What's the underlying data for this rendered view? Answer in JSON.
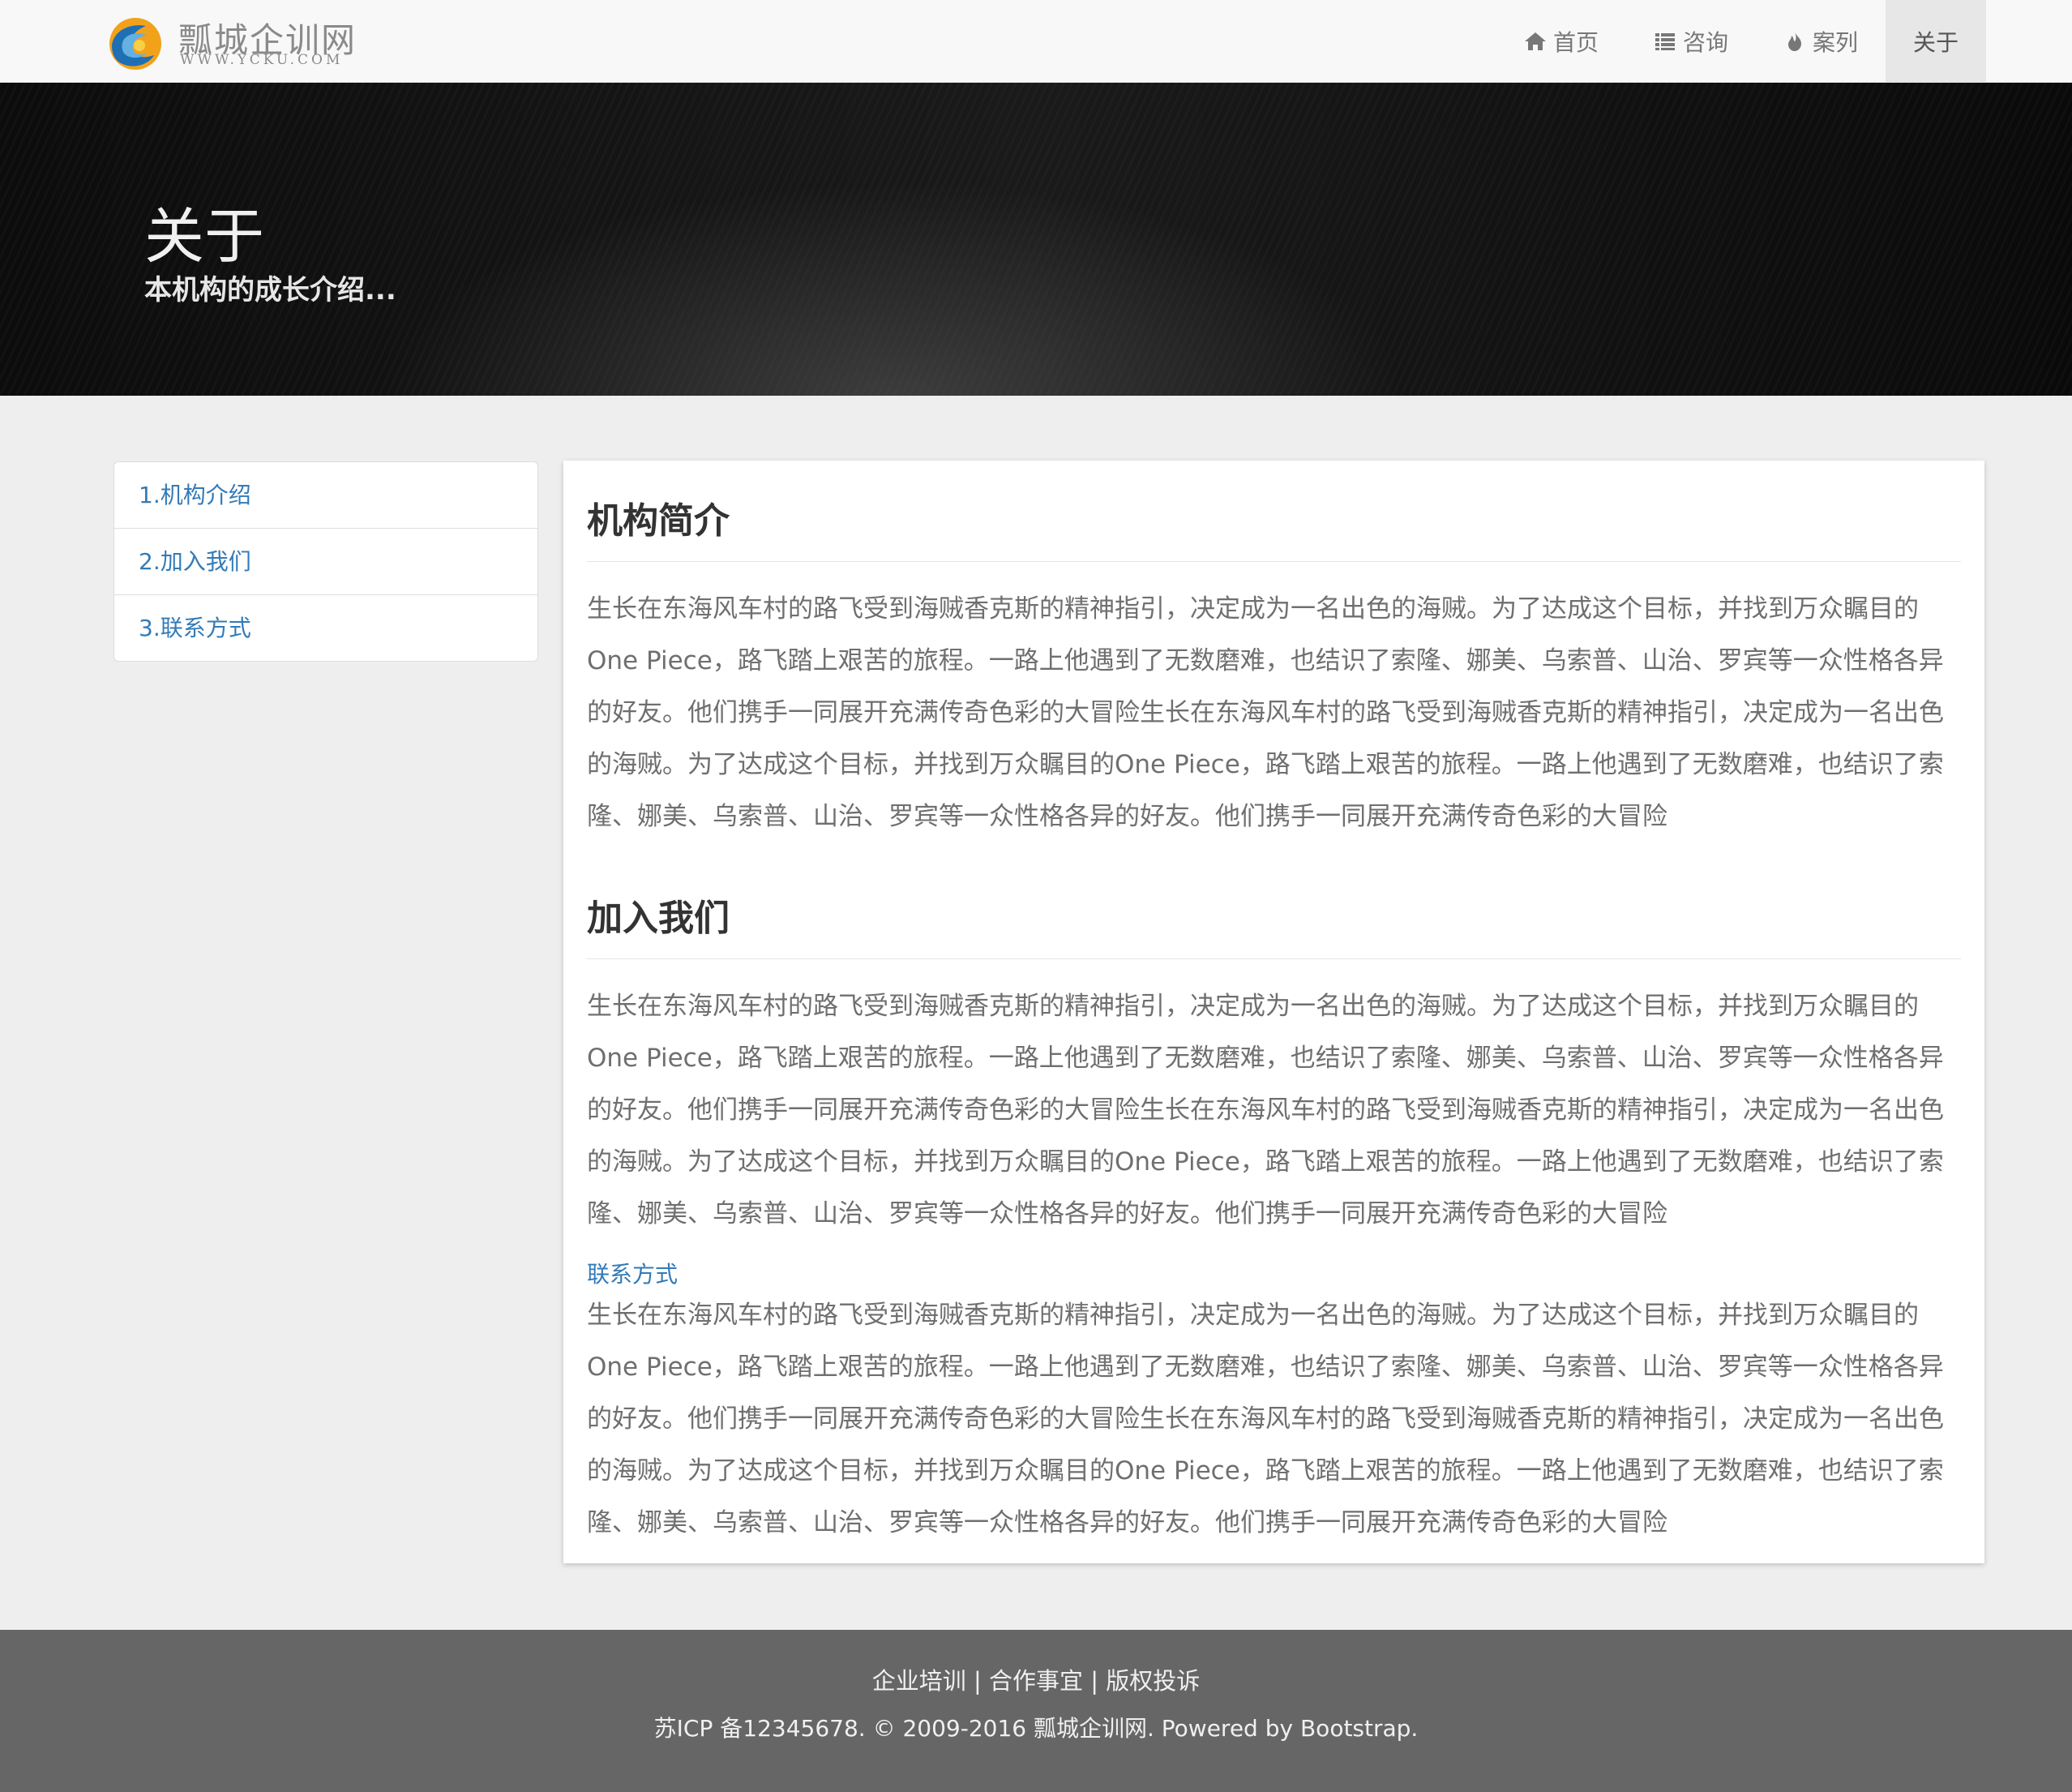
{
  "brand": {
    "title": "瓢城企训网",
    "subtitle": "WWW.YCKU.COM"
  },
  "nav": {
    "items": [
      {
        "label": "首页",
        "icon": "home-icon"
      },
      {
        "label": "咨询",
        "icon": "list-icon"
      },
      {
        "label": "案列",
        "icon": "fire-icon"
      },
      {
        "label": "关于",
        "icon": ""
      }
    ],
    "active_index": 3
  },
  "hero": {
    "title": "关于",
    "subtitle": "本机构的成长介绍..."
  },
  "sidebar": {
    "items": [
      {
        "label": "1.机构介绍"
      },
      {
        "label": "2.加入我们"
      },
      {
        "label": "3.联系方式"
      }
    ]
  },
  "content": {
    "sections": [
      {
        "heading": "机构简介",
        "text": "生长在东海风车村的路飞受到海贼香克斯的精神指引，决定成为一名出色的海贼。为了达成这个目标，并找到万众瞩目的One Piece，路飞踏上艰苦的旅程。一路上他遇到了无数磨难，也结识了索隆、娜美、乌索普、山治、罗宾等一众性格各异的好友。他们携手一同展开充满传奇色彩的大冒险生长在东海风车村的路飞受到海贼香克斯的精神指引，决定成为一名出色的海贼。为了达成这个目标，并找到万众瞩目的One Piece，路飞踏上艰苦的旅程。一路上他遇到了无数磨难，也结识了索隆、娜美、乌索普、山治、罗宾等一众性格各异的好友。他们携手一同展开充满传奇色彩的大冒险"
      },
      {
        "heading": "加入我们",
        "text": "生长在东海风车村的路飞受到海贼香克斯的精神指引，决定成为一名出色的海贼。为了达成这个目标，并找到万众瞩目的One Piece，路飞踏上艰苦的旅程。一路上他遇到了无数磨难，也结识了索隆、娜美、乌索普、山治、罗宾等一众性格各异的好友。他们携手一同展开充满传奇色彩的大冒险生长在东海风车村的路飞受到海贼香克斯的精神指引，决定成为一名出色的海贼。为了达成这个目标，并找到万众瞩目的One Piece，路飞踏上艰苦的旅程。一路上他遇到了无数磨难，也结识了索隆、娜美、乌索普、山治、罗宾等一众性格各异的好友。他们携手一同展开充满传奇色彩的大冒险"
      }
    ],
    "contact": {
      "label": "联系方式",
      "text": "生长在东海风车村的路飞受到海贼香克斯的精神指引，决定成为一名出色的海贼。为了达成这个目标，并找到万众瞩目的One Piece，路飞踏上艰苦的旅程。一路上他遇到了无数磨难，也结识了索隆、娜美、乌索普、山治、罗宾等一众性格各异的好友。他们携手一同展开充满传奇色彩的大冒险生长在东海风车村的路飞受到海贼香克斯的精神指引，决定成为一名出色的海贼。为了达成这个目标，并找到万众瞩目的One Piece，路飞踏上艰苦的旅程。一路上他遇到了无数磨难，也结识了索隆、娜美、乌索普、山治、罗宾等一众性格各异的好友。他们携手一同展开充满传奇色彩的大冒险"
    }
  },
  "footer": {
    "links": "企业培训 | 合作事宜 | 版权投诉",
    "copyright": "苏ICP 备12345678. © 2009-2016 瓢城企训网. Powered by Bootstrap."
  },
  "colors": {
    "link": "#337ab7",
    "navbar_bg": "#f8f8f8",
    "page_bg": "#eeeeee",
    "footer_bg": "#666666",
    "text_muted": "#6f6f6f"
  }
}
